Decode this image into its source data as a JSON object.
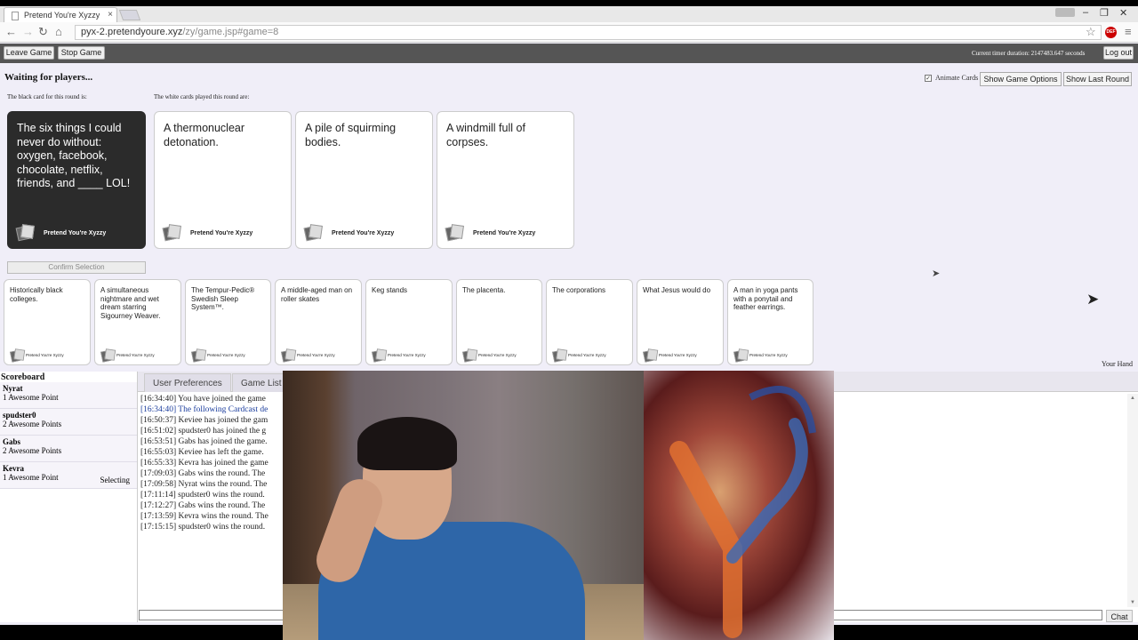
{
  "browser": {
    "tab_title": "Pretend You're Xyzzy",
    "url_host": "pyx-2.pretendyoure.xyz",
    "url_path": "/zy/game.jsp#game=8",
    "extension_badge": "DEF"
  },
  "header": {
    "leave_game": "Leave Game",
    "stop_game": "Stop Game",
    "timer": "Current timer duration: 2147483.647 seconds",
    "log_out": "Log out"
  },
  "game": {
    "status": "Waiting for players...",
    "black_card_label": "The black card for this round is:",
    "white_cards_label": "The white cards played this round are:",
    "animate_label": "Animate Cards",
    "show_options": "Show Game Options",
    "show_last_round": "Show Last Round",
    "confirm": "Confirm Selection",
    "brand": "Pretend You're Xyzzy",
    "black_card": "The six things I could never do without: oxygen, facebook, chocolate, netflix, friends, and ____ LOL!",
    "played_cards": [
      "A thermonuclear detonation.",
      "A pile of squirming bodies.",
      "A windmill full of corpses."
    ],
    "hand": [
      "Historically black colleges.",
      "A simultaneous nightmare and wet dream starring Sigourney Weaver.",
      "The Tempur-Pedic® Swedish Sleep System™.",
      "A middle-aged man on roller skates",
      "Keg stands",
      "The placenta.",
      "The corporations",
      "What Jesus would do",
      "A man in yoga pants with a ponytail and feather earrings."
    ],
    "your_hand_label": "Your Hand"
  },
  "scoreboard": {
    "title": "Scoreboard",
    "players": [
      {
        "name": "Nyrat",
        "score": "1 Awesome Point",
        "status": ""
      },
      {
        "name": "spudster0",
        "score": "2 Awesome Points",
        "status": ""
      },
      {
        "name": "Gabs",
        "score": "2 Awesome Points",
        "status": ""
      },
      {
        "name": "Kevra",
        "score": "1 Awesome Point",
        "status": "Selecting"
      }
    ]
  },
  "bottom": {
    "tabs": [
      "User Preferences",
      "Game List"
    ],
    "chat_button": "Chat",
    "log": [
      "[16:34:40] You have joined the game",
      "[16:34:40] The following Cardcast de",
      "[16:50:37] Keviee has joined the gam",
      "[16:51:02] spudster0 has joined the g",
      "[16:53:51] Gabs has joined the game.",
      "[16:55:03] Keviee has left the game.",
      "[16:55:33] Kevra has joined the game",
      "[17:09:03] Gabs wins the round. The",
      "[17:09:58] Nyrat wins the round. The",
      "[17:11:14] spudster0 wins the round.",
      "[17:12:27] Gabs wins the round. The",
      "[17:13:59] Kevra wins the round. The",
      "[17:15:15] spudster0 wins the round."
    ]
  },
  "icons": {
    "back": "arrow-left",
    "forward": "arrow-right",
    "reload": "reload",
    "home": "home",
    "star": "star",
    "menu": "hamburger",
    "cursor": "mouse-pointer"
  },
  "colors": {
    "page_bg": "#f0eef8",
    "topbar": "#555555",
    "black_card": "#2b2b2b",
    "log_link": "#1a3c9c"
  }
}
